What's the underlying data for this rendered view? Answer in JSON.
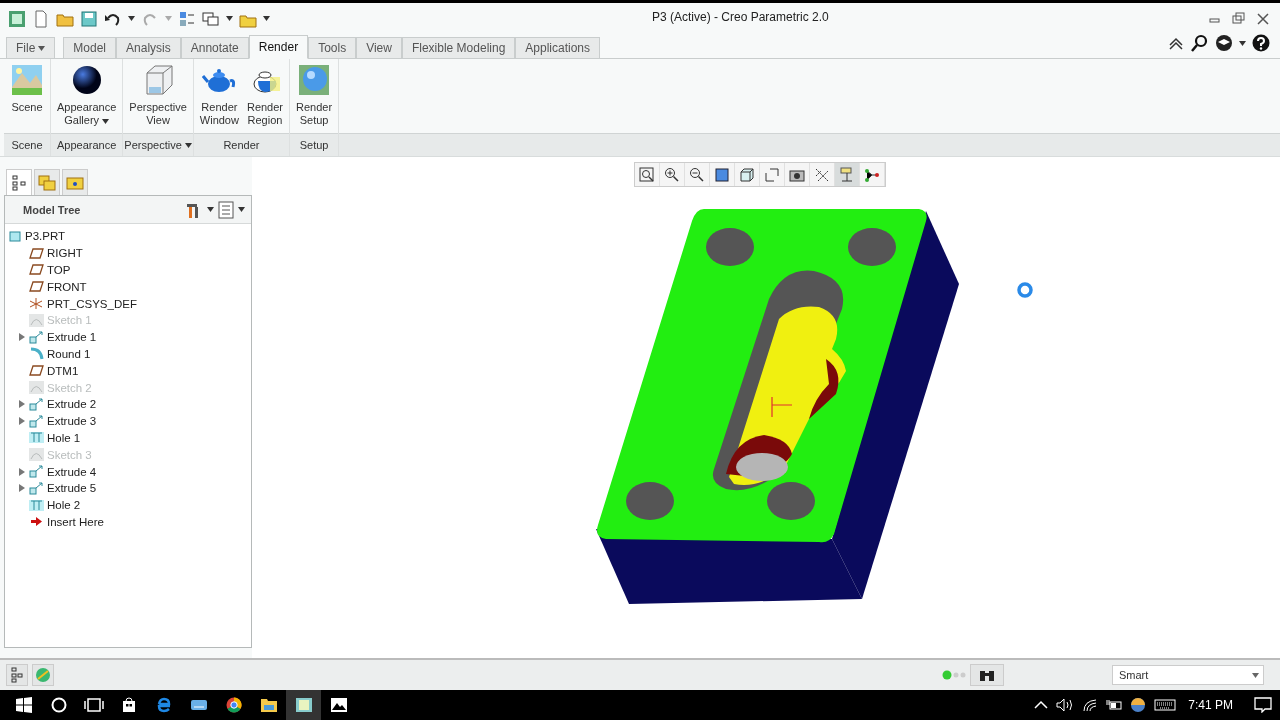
{
  "window": {
    "title": "P3 (Active) - Creo Parametric 2.0"
  },
  "tabs": [
    {
      "label": "File",
      "kind": "menu",
      "selected": false
    },
    {
      "label": "Model",
      "kind": "tab",
      "selected": false
    },
    {
      "label": "Analysis",
      "kind": "tab",
      "selected": false
    },
    {
      "label": "Annotate",
      "kind": "tab",
      "selected": false
    },
    {
      "label": "Render",
      "kind": "tab",
      "selected": true
    },
    {
      "label": "Tools",
      "kind": "tab",
      "selected": false
    },
    {
      "label": "View",
      "kind": "tab",
      "selected": false
    },
    {
      "label": "Flexible Modeling",
      "kind": "tab",
      "selected": false
    },
    {
      "label": "Applications",
      "kind": "tab",
      "selected": false
    }
  ],
  "ribbon": [
    {
      "label": "Scene",
      "dropdown": false,
      "buttons": [
        {
          "kind": "scene",
          "label": "Scene",
          "dropdown": false
        }
      ]
    },
    {
      "label": "Appearance",
      "dropdown": false,
      "buttons": [
        {
          "kind": "sphere",
          "label": "Appearance\nGallery",
          "dropdown": true
        }
      ]
    },
    {
      "label": "Perspective",
      "dropdown": true,
      "buttons": [
        {
          "kind": "cube",
          "label": "Perspective\nView",
          "dropdown": false
        }
      ]
    },
    {
      "label": "Render",
      "dropdown": false,
      "buttons": [
        {
          "kind": "teapot",
          "label": "Render\nWindow",
          "dropdown": false
        },
        {
          "kind": "teapot-half",
          "label": "Render\nRegion",
          "dropdown": false
        }
      ]
    },
    {
      "label": "Setup",
      "dropdown": false,
      "buttons": [
        {
          "kind": "globe",
          "label": "Render\nSetup",
          "dropdown": false
        }
      ]
    }
  ],
  "model_tree": {
    "title": "Model Tree",
    "root": "P3.PRT",
    "items": [
      {
        "kind": "plane",
        "label": "RIGHT",
        "expander": false,
        "dimmed": false
      },
      {
        "kind": "plane",
        "label": "TOP",
        "expander": false,
        "dimmed": false
      },
      {
        "kind": "plane",
        "label": "FRONT",
        "expander": false,
        "dimmed": false
      },
      {
        "kind": "csys",
        "label": "PRT_CSYS_DEF",
        "expander": false,
        "dimmed": false
      },
      {
        "kind": "sketch",
        "label": "Sketch 1",
        "expander": false,
        "dimmed": true
      },
      {
        "kind": "extrude",
        "label": "Extrude 1",
        "expander": true,
        "dimmed": false
      },
      {
        "kind": "round",
        "label": "Round 1",
        "expander": false,
        "dimmed": false
      },
      {
        "kind": "plane",
        "label": "DTM1",
        "expander": false,
        "dimmed": false
      },
      {
        "kind": "sketch",
        "label": "Sketch 2",
        "expander": false,
        "dimmed": true
      },
      {
        "kind": "extrude",
        "label": "Extrude 2",
        "expander": true,
        "dimmed": false
      },
      {
        "kind": "extrude",
        "label": "Extrude 3",
        "expander": true,
        "dimmed": false
      },
      {
        "kind": "hole",
        "label": "Hole 1",
        "expander": false,
        "dimmed": false
      },
      {
        "kind": "sketch",
        "label": "Sketch 3",
        "expander": false,
        "dimmed": true
      },
      {
        "kind": "extrude",
        "label": "Extrude 4",
        "expander": true,
        "dimmed": false
      },
      {
        "kind": "extrude",
        "label": "Extrude 5",
        "expander": true,
        "dimmed": false
      },
      {
        "kind": "hole",
        "label": "Hole 2",
        "expander": false,
        "dimmed": false
      },
      {
        "kind": "insert",
        "label": "Insert Here",
        "expander": false,
        "dimmed": false
      }
    ]
  },
  "status_bar": {
    "filter": "Smart"
  },
  "taskbar": {
    "time": "7:41 PM"
  }
}
